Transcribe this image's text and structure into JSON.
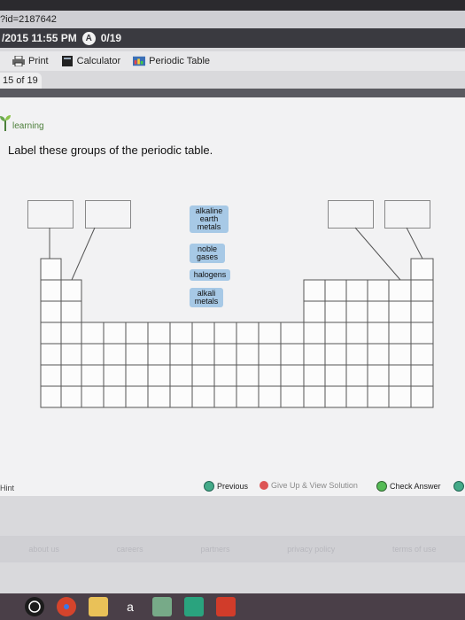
{
  "browser": {
    "url": "?id=2187642"
  },
  "status": {
    "datetime": "/2015 11:55 PM",
    "score_icon": "A",
    "score": "0/19"
  },
  "toolbar": {
    "print": "Print",
    "calculator": "Calculator",
    "periodic_table": "Periodic Table"
  },
  "progress": {
    "label": "15 of 19"
  },
  "brand": {
    "text": "learning"
  },
  "question": {
    "text": "Label these groups of the periodic table."
  },
  "chips": [
    "alkaline earth metals",
    "noble gases",
    "halogens",
    "alkali metals"
  ],
  "footer": {
    "hint": "Hint",
    "previous": "Previous",
    "give_up": "Give Up & View Solution",
    "check": "Check Answer"
  },
  "links": [
    "about us",
    "careers",
    "partners",
    "privacy policy",
    "terms of use"
  ],
  "taskbar": {
    "icons": [
      "hp-icon",
      "chrome-icon",
      "folder-icon",
      "amazon-icon",
      "media-icon",
      "sway-icon",
      "office-icon"
    ],
    "amazon_label": "a"
  },
  "colors": {
    "chip": "#a7c9e6",
    "status_bg": "#3a3a40",
    "brand": "#4c7f3a"
  }
}
